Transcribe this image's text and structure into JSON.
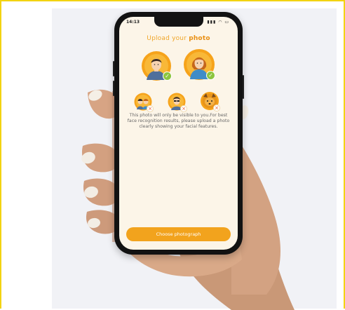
{
  "status_bar": {
    "time": "14:13",
    "icons_text": "▮▮▮ ◠ ▭"
  },
  "screen": {
    "title_prefix": "Upload your ",
    "title_highlight": "photo",
    "description": "This photo will only be visible to you.For best face recognition results, please upload a photo clearly showing your facial features.",
    "choose_button_label": "Choose photograph"
  },
  "icons": {
    "check": "✓",
    "cross": "×"
  },
  "colors": {
    "frame_border": "#f3d311",
    "accent": "#f2a31d",
    "screen_bg": "#fcf5e8",
    "valid": "#8cc53f",
    "invalid": "#e35b2f"
  }
}
